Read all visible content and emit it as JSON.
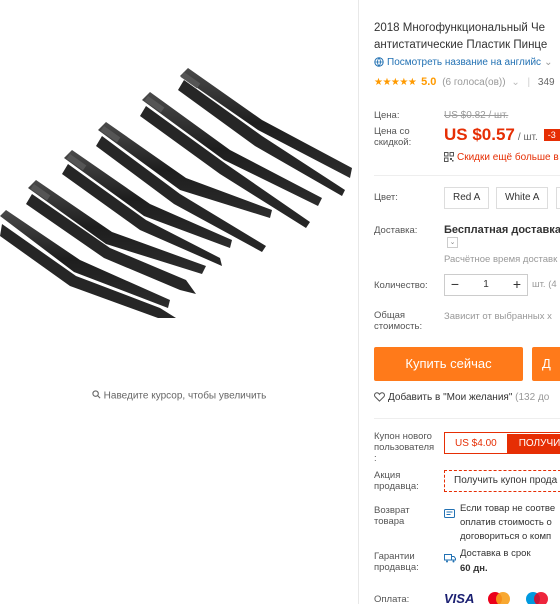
{
  "gallery": {
    "hover_hint": "Наведите курсор, чтобы увеличить"
  },
  "product": {
    "title_line1": "2018 Многофункциональный Че",
    "title_line2": "антистатические Пластик Пинце",
    "translate_link": "Посмотреть название на английс",
    "rating": {
      "stars": "★★★★★",
      "score": "5.0",
      "votes": "(6 голоса(ов))",
      "orders": "349"
    }
  },
  "price": {
    "label_price": "Цена:",
    "old": "US $0.82 / шт.",
    "label_discount_line1": "Цена со",
    "label_discount_line2": "скидкой:",
    "current": "US $0.57",
    "unit": "/ шт.",
    "discount_badge": "-3",
    "promo": "Скидки ещё больше в"
  },
  "options": {
    "color_label": "Цвет:",
    "colors": [
      "Red A",
      "White A",
      ""
    ]
  },
  "shipping": {
    "label": "Доставка:",
    "value": "Бесплатная доставка в",
    "time": "Расчётное время доставк"
  },
  "quantity": {
    "label": "Количество:",
    "value": "1",
    "note": "шт. (4"
  },
  "total": {
    "label_line1": "Общая",
    "label_line2": "стоимость:",
    "value": "Зависит от выбранных х"
  },
  "actions": {
    "buy_now": "Купить сейчас",
    "add_to_cart": "Д",
    "wishlist": "Добавить в \"Мои желания\"",
    "wishlist_count": "(132 до"
  },
  "coupons": {
    "new_user_label_line1": "Купон нового",
    "new_user_label_line2": "пользователя",
    "new_user_label_line3": ":",
    "new_user_amount": "US $4.00",
    "new_user_button": "ПОЛУЧИ",
    "seller_label_line1": "Акция",
    "seller_label_line2": "продавца:",
    "seller_button": "Получить купон прода"
  },
  "returns": {
    "label_line1": "Возврат",
    "label_line2": "товара",
    "line1": "Если товар не соотве",
    "line2": "оплатив стоимость о",
    "line3": "договориться о комп"
  },
  "guarantee": {
    "label_line1": "Гарантии",
    "label_line2": "продавца:",
    "text": "Доставка в срок",
    "days": "60 дн."
  },
  "payment": {
    "label": "Оплата:",
    "visa": "VISA",
    "card2": "MasterCard",
    "card3": "Maestro"
  },
  "colors": {
    "accent_orange": "#ff7a1a",
    "price_red": "#e62e04",
    "link_blue": "#2271b3",
    "star_orange": "#ff9a00"
  }
}
